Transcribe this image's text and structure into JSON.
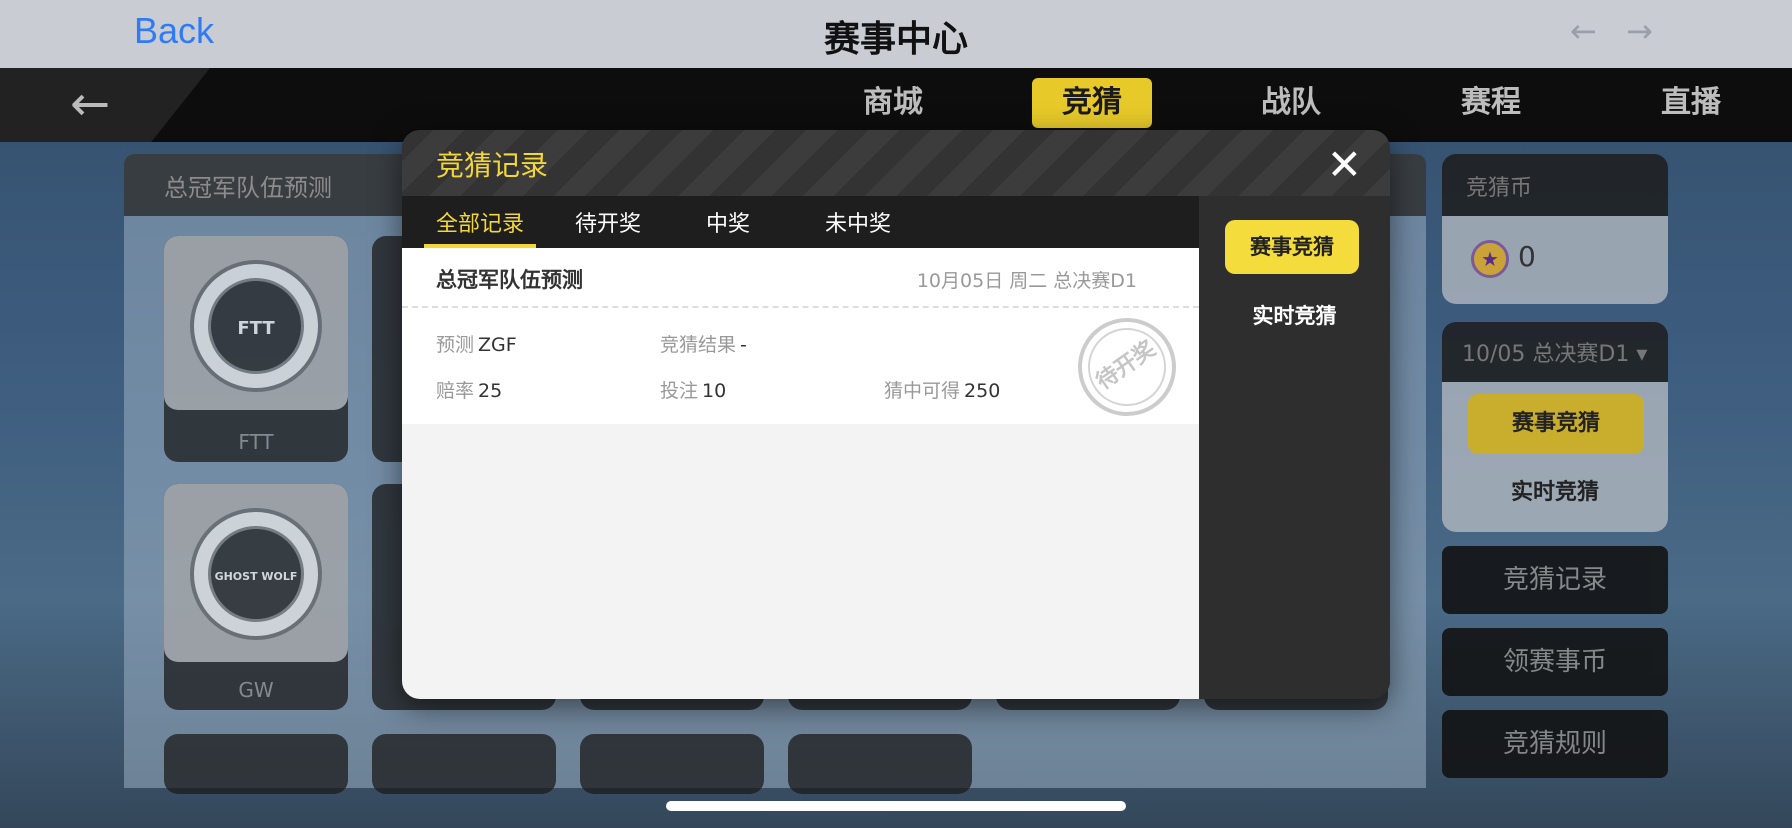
{
  "browser": {
    "back_label": "Back",
    "title": "赛事中心",
    "prev_arrow": "←",
    "next_arrow": "→"
  },
  "game_nav": {
    "back_arrow": "🡐",
    "tabs": [
      {
        "label": "商城",
        "active": false
      },
      {
        "label": "竞猜",
        "active": true
      },
      {
        "label": "战队",
        "active": false
      },
      {
        "label": "赛程",
        "active": false
      },
      {
        "label": "直播",
        "active": false
      }
    ]
  },
  "left_panel": {
    "title": "总冠军队伍预测",
    "teams": [
      {
        "name": "FTT",
        "logo_text": "FTT"
      },
      {
        "name": "GW",
        "logo_text": "GHOST WOLF"
      }
    ]
  },
  "right_column": {
    "coin_label": "竞猜币",
    "coin_value": "0",
    "match_selector": "10/05 总决赛D1 ▾",
    "event_bet_button": "赛事竞猜",
    "live_bet_link": "实时竞猜",
    "menu": [
      "竞猜记录",
      "领赛事币",
      "竞猜规则"
    ]
  },
  "modal": {
    "title": "竞猜记录",
    "close_icon": "✕",
    "tabs": [
      {
        "label": "全部记录",
        "active": true
      },
      {
        "label": "待开奖",
        "active": false
      },
      {
        "label": "中奖",
        "active": false
      },
      {
        "label": "未中奖",
        "active": false
      }
    ],
    "record": {
      "title": "总冠军队伍预测",
      "date": "10月05日 周二 总决赛D1",
      "prediction_label": "预测",
      "prediction_value": "ZGF",
      "result_label": "竞猜结果",
      "result_value": "-",
      "odds_label": "赔率",
      "odds_value": "25",
      "bet_label": "投注",
      "bet_value": "10",
      "win_label": "猜中可得",
      "win_value": "250",
      "stamp": "待开奖"
    },
    "side": {
      "event_bet_button": "赛事竞猜",
      "live_bet_link": "实时竞猜"
    }
  },
  "colors": {
    "accent_yellow": "#f5dc3d",
    "link_blue": "#2f7bf6"
  }
}
